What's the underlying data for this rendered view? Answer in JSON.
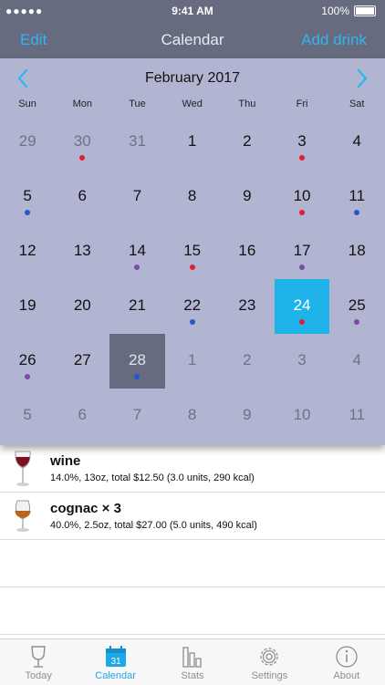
{
  "status_bar": {
    "carrier": "●●●●●",
    "time": "9:41 AM",
    "battery": "100%"
  },
  "nav": {
    "left": "Edit",
    "title": "Calendar",
    "right": "Add drink"
  },
  "calendar": {
    "month": "February 2017",
    "weekdays": [
      "Sun",
      "Mon",
      "Tue",
      "Wed",
      "Thu",
      "Fri",
      "Sat"
    ],
    "weeks": [
      [
        {
          "d": "29",
          "m": true
        },
        {
          "d": "30",
          "m": true,
          "dot": "red"
        },
        {
          "d": "31",
          "m": true
        },
        {
          "d": "1"
        },
        {
          "d": "2"
        },
        {
          "d": "3",
          "dot": "red"
        },
        {
          "d": "4"
        }
      ],
      [
        {
          "d": "5",
          "dot": "blue"
        },
        {
          "d": "6"
        },
        {
          "d": "7"
        },
        {
          "d": "8"
        },
        {
          "d": "9"
        },
        {
          "d": "10",
          "dot": "red"
        },
        {
          "d": "11",
          "dot": "blue"
        }
      ],
      [
        {
          "d": "12"
        },
        {
          "d": "13"
        },
        {
          "d": "14",
          "dot": "purple"
        },
        {
          "d": "15",
          "dot": "red"
        },
        {
          "d": "16"
        },
        {
          "d": "17",
          "dot": "purple"
        },
        {
          "d": "18"
        }
      ],
      [
        {
          "d": "19"
        },
        {
          "d": "20"
        },
        {
          "d": "21"
        },
        {
          "d": "22",
          "dot": "blue"
        },
        {
          "d": "23"
        },
        {
          "d": "24",
          "dot": "red",
          "selected": true
        },
        {
          "d": "25",
          "dot": "purple"
        }
      ],
      [
        {
          "d": "26",
          "dot": "purple"
        },
        {
          "d": "27"
        },
        {
          "d": "28",
          "dot": "blue",
          "today": true
        },
        {
          "d": "1",
          "m": true
        },
        {
          "d": "2",
          "m": true
        },
        {
          "d": "3",
          "m": true
        },
        {
          "d": "4",
          "m": true
        }
      ],
      [
        {
          "d": "5",
          "m": true
        },
        {
          "d": "6",
          "m": true
        },
        {
          "d": "7",
          "m": true
        },
        {
          "d": "8",
          "m": true
        },
        {
          "d": "9",
          "m": true
        },
        {
          "d": "10",
          "m": true
        },
        {
          "d": "11",
          "m": true
        }
      ]
    ],
    "dot_colors": {
      "red": "#e11c36",
      "blue": "#2259c9",
      "purple": "#7d4aa6"
    }
  },
  "entries": [
    {
      "name": "wine",
      "detail": "14.0%, 13oz, total $12.50 (3.0 units, 290 kcal)",
      "icon": "wine-glass-icon"
    },
    {
      "name": "cognac × 3",
      "detail": "40.0%, 2.5oz, total $27.00 (5.0 units, 490 kcal)",
      "icon": "cognac-glass-icon"
    }
  ],
  "tabs": [
    {
      "label": "Today",
      "icon": "glass-icon"
    },
    {
      "label": "Calendar",
      "icon": "calendar-icon",
      "calendar_num": "31"
    },
    {
      "label": "Stats",
      "icon": "bar-chart-icon"
    },
    {
      "label": "Settings",
      "icon": "gear-icon"
    },
    {
      "label": "About",
      "icon": "info-icon"
    }
  ],
  "colors": {
    "accent": "#1fb3ea",
    "nav_bg": "#666b80",
    "calendar_bg": "#b2b5d2"
  }
}
